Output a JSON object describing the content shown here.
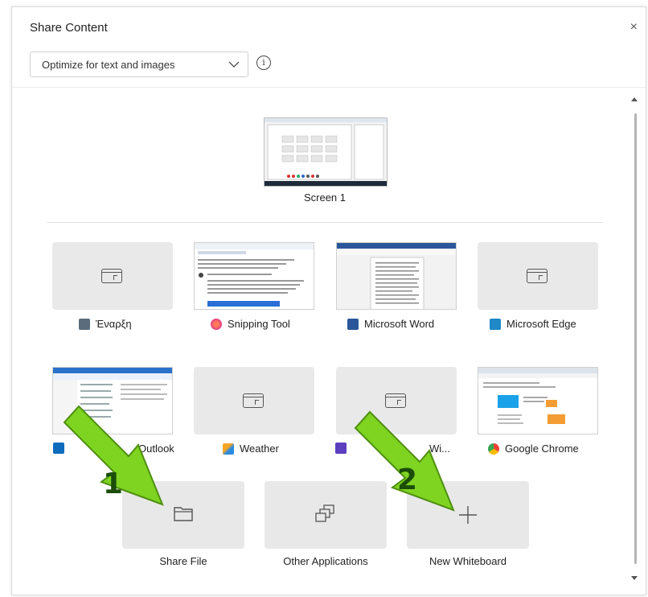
{
  "dialog": {
    "title": "Share Content",
    "close_glyph": "×",
    "optimize_select": {
      "value": "Optimize for text and images"
    },
    "info_glyph": "i"
  },
  "screens": [
    {
      "label": "Screen 1"
    }
  ],
  "windows": [
    {
      "label": "Έναρξη",
      "icon": "start-icon",
      "preview": "placeholder"
    },
    {
      "label": "Snipping Tool",
      "icon": "snipping-tool-icon",
      "preview": "image"
    },
    {
      "label": "Microsoft Word",
      "icon": "word-icon",
      "preview": "image"
    },
    {
      "label": "Microsoft Edge",
      "icon": "edge-icon",
      "preview": "placeholder"
    },
    {
      "label": "Outlook",
      "icon": "outlook-icon",
      "preview": "image"
    },
    {
      "label": "Weather",
      "icon": "weather-icon",
      "preview": "placeholder"
    },
    {
      "label": "Wi...",
      "icon": "purple-app-icon",
      "preview": "placeholder"
    },
    {
      "label": "Google Chrome",
      "icon": "chrome-icon",
      "preview": "image"
    }
  ],
  "actions": [
    {
      "label": "Share File",
      "icon": "folder-icon"
    },
    {
      "label": "Other Applications",
      "icon": "stacked-windows-icon"
    },
    {
      "label": "New Whiteboard",
      "icon": "plus-icon"
    }
  ],
  "annotations": [
    {
      "number": "1",
      "color": "#7fd321"
    },
    {
      "number": "2",
      "color": "#7fd321"
    }
  ],
  "colors": {
    "accent_green": "#7fd321",
    "tile_bg": "#e9e9e9"
  }
}
